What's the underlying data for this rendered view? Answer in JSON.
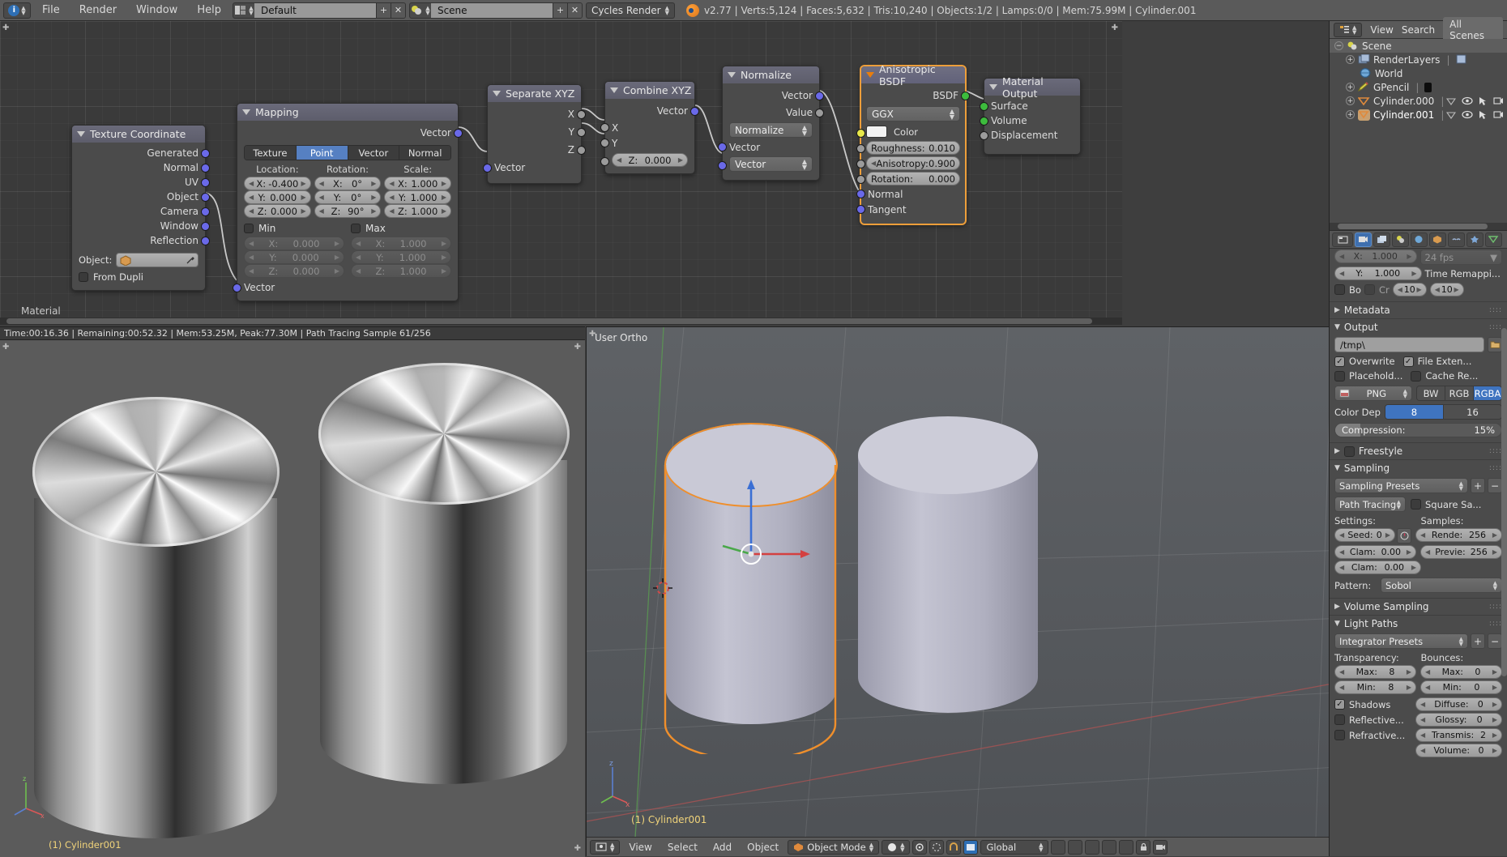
{
  "topbar": {
    "app_icon": "blender-info-icon",
    "menus": [
      "File",
      "Render",
      "Window",
      "Help"
    ],
    "screen_layout": {
      "icon": "screen-layout-icon",
      "value": "Default",
      "add": "+",
      "remove": "✕"
    },
    "scene_select": {
      "icon": "scene-icon",
      "value": "Scene",
      "add": "+",
      "remove": "✕"
    },
    "engine": {
      "value": "Cycles Render"
    },
    "stats": "v2.77 | Verts:5,124 | Faces:5,632 | Tris:10,240 | Objects:1/2 | Lamps:0/0 | Mem:75.99M | Cylinder.001"
  },
  "node_editor": {
    "footer_label": "Material",
    "nodes": {
      "texture_coordinate": {
        "title": "Texture Coordinate",
        "outputs": [
          "Generated",
          "Normal",
          "UV",
          "Object",
          "Camera",
          "Window",
          "Reflection"
        ],
        "object_label": "Object:",
        "object_value": "",
        "from_dupli_label": "From Dupli"
      },
      "mapping": {
        "title": "Mapping",
        "output": "Vector",
        "input": "Vector",
        "types": [
          "Texture",
          "Point",
          "Vector",
          "Normal"
        ],
        "active_type": "Point",
        "columns": [
          "Location:",
          "Rotation:",
          "Scale:"
        ],
        "location": {
          "x": "-0.400",
          "y": "0.000",
          "z": "0.000"
        },
        "rotation": {
          "x": "0°",
          "y": "0°",
          "z": "90°"
        },
        "scale": {
          "x": "1.000",
          "y": "1.000",
          "z": "1.000"
        },
        "min_label": "Min",
        "max_label": "Max",
        "min": {
          "x": "0.000",
          "y": "0.000",
          "z": "0.000"
        },
        "max": {
          "x": "1.000",
          "y": "1.000",
          "z": "1.000"
        },
        "axis_labels": {
          "x": "X:",
          "y": "Y:",
          "z": "Z:"
        }
      },
      "separate_xyz": {
        "title": "Separate XYZ",
        "outputs": [
          "X",
          "Y",
          "Z"
        ],
        "input": "Vector"
      },
      "combine_xyz": {
        "title": "Combine XYZ",
        "output": "Vector",
        "inputs": [
          "X",
          "Y"
        ],
        "z_label": "Z:",
        "z_value": "0.000"
      },
      "normalize": {
        "title": "Normalize",
        "outputs": [
          "Vector",
          "Value"
        ],
        "operation": "Normalize",
        "input_label": "Vector",
        "mode": "Vector"
      },
      "anisotropic_bsdf": {
        "title": "Anisotropic BSDF",
        "output": "BSDF",
        "distribution": "GGX",
        "color_label": "Color",
        "color_value": "#f2f2f2",
        "roughness": {
          "label": "Roughness:",
          "value": "0.010"
        },
        "anisotropy": {
          "label": "Anisotropy:",
          "value": "0.900"
        },
        "rotation": {
          "label": "Rotation:",
          "value": "0.000"
        },
        "normal_label": "Normal",
        "tangent_label": "Tangent"
      },
      "material_output": {
        "title": "Material Output",
        "inputs": [
          "Surface",
          "Volume",
          "Displacement"
        ]
      }
    }
  },
  "render_view": {
    "status": "Time:00:16.36 | Remaining:00:52.32 | Mem:53.25M, Peak:77.30M | Path Tracing Sample 61/256",
    "object_tag": "(1) Cylinder001"
  },
  "viewport": {
    "view_label": "User Ortho",
    "object_tag": "(1) Cylinder001",
    "footer": {
      "editor_icon": "viewport-editor-icon",
      "menus": [
        "View",
        "Select",
        "Add",
        "Object"
      ],
      "mode": "Object Mode",
      "shading_icon": "shading-solid-icon",
      "transform_orientation": "Global",
      "snap_icon": "magnet-icon",
      "proportional_icon": "proportional-edit-icon"
    }
  },
  "outliner": {
    "header": {
      "icon": "outliner-icon",
      "view": "View",
      "search": "Search",
      "display_mode": "All Scenes"
    },
    "rows": [
      {
        "label": "Scene",
        "icon": "scene-icon",
        "indent": 0,
        "expander": "−",
        "selected": true
      },
      {
        "label": "RenderLayers",
        "icon": "renderlayers-icon",
        "indent": 1,
        "expander": "+",
        "selected": false
      },
      {
        "label": "World",
        "icon": "world-icon",
        "indent": 1,
        "expander": "",
        "selected": false
      },
      {
        "label": "GPencil",
        "icon": "pencil-icon",
        "indent": 1,
        "expander": "+",
        "selected": false
      },
      {
        "label": "Cylinder.000",
        "icon": "mesh-icon",
        "indent": 1,
        "expander": "+",
        "selected": false
      },
      {
        "label": "Cylinder.001",
        "icon": "mesh-icon",
        "indent": 1,
        "expander": "+",
        "selected": true
      }
    ]
  },
  "properties": {
    "tabs": [
      "render-tab",
      "renderlayers-tab",
      "scene-tab",
      "world-tab",
      "object-tab",
      "constraints-tab",
      "modifiers-tab",
      "data-tab"
    ],
    "active_tab_index": 0,
    "dimensions": {
      "y_label": "Y:",
      "y_value": "1.000",
      "fps_value": "24 fps",
      "time_remap_label": "Time Remappi...",
      "remap_old": "10",
      "remap_new": "10",
      "bo_label": "Bo",
      "cr_label": "Cr"
    },
    "metadata_section": "Metadata",
    "output_section": "Output",
    "output": {
      "path": "/tmp\\",
      "overwrite": "Overwrite",
      "file_extensions": "File Exten...",
      "placeholders": "Placehold...",
      "cache_result": "Cache Re...",
      "format": "PNG",
      "channels": [
        "BW",
        "RGB",
        "RGBA"
      ],
      "active_channel": "RGBA",
      "color_depth_label": "Color Dep",
      "color_depths": [
        "8",
        "16"
      ],
      "active_depth": "8",
      "compression_label": "Compression:",
      "compression_value": "15%",
      "compression_percent": 15
    },
    "freestyle_section": "Freestyle",
    "sampling_section": "Sampling",
    "sampling": {
      "presets": "Sampling Presets",
      "integrator": "Path Tracing",
      "square_samples": "Square Sa...",
      "settings_label": "Settings:",
      "samples_label": "Samples:",
      "seed": {
        "label": "Seed:",
        "value": "0"
      },
      "clamp_direct": {
        "label": "Clam:",
        "value": "0.00"
      },
      "clamp_indirect": {
        "label": "Clam:",
        "value": "0.00"
      },
      "render_samples": {
        "label": "Rende:",
        "value": "256"
      },
      "preview_samples": {
        "label": "Previe:",
        "value": "256"
      },
      "pattern_label": "Pattern:",
      "pattern_value": "Sobol"
    },
    "volume_sampling_section": "Volume Sampling",
    "light_paths_section": "Light Paths",
    "light_paths": {
      "presets": "Integrator Presets",
      "transparency_label": "Transparency:",
      "bounces_label": "Bounces:",
      "transp_max": {
        "label": "Max:",
        "value": "8"
      },
      "transp_min": {
        "label": "Min:",
        "value": "8"
      },
      "bounce_max": {
        "label": "Max:",
        "value": "0"
      },
      "bounce_min": {
        "label": "Min:",
        "value": "0"
      },
      "shadows": "Shadows",
      "diffuse": {
        "label": "Diffuse:",
        "value": "0"
      },
      "glossy": {
        "label": "Glossy:",
        "value": "0"
      },
      "transmission": {
        "label": "Transmis:",
        "value": "2"
      },
      "volume": {
        "label": "Volume:",
        "value": "0"
      },
      "reflective": "Reflective...",
      "refractive": "Refractive..."
    }
  }
}
